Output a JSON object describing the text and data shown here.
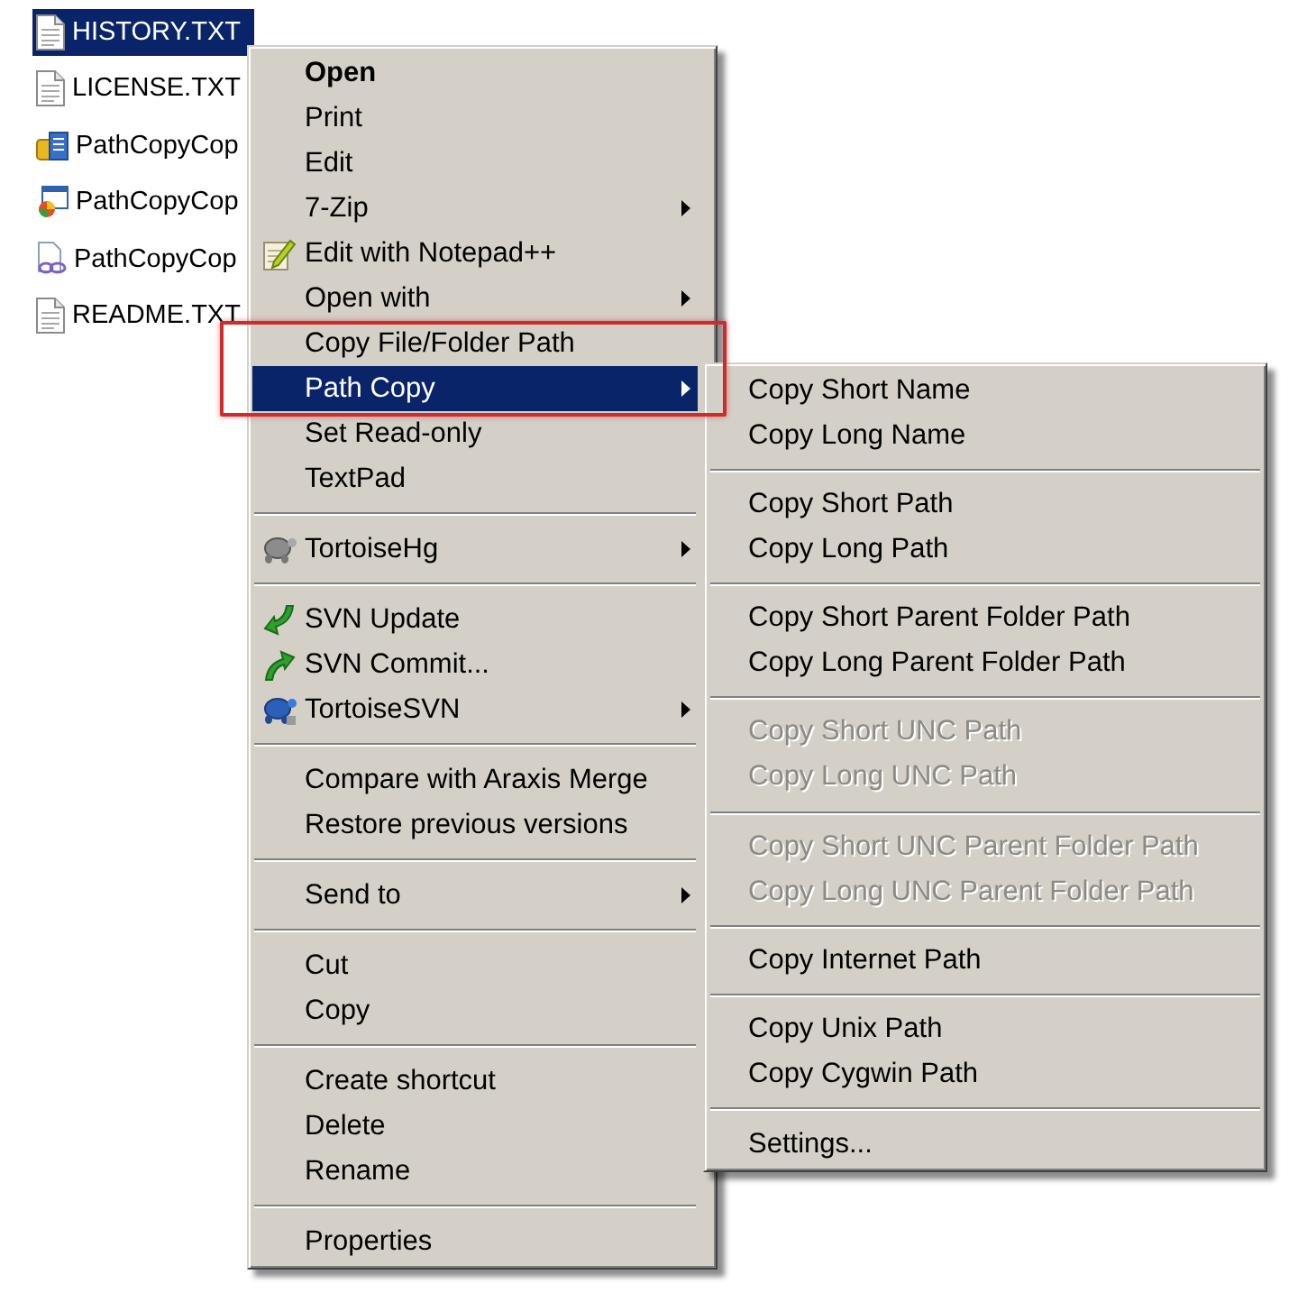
{
  "files": [
    {
      "name": "HISTORY.TXT",
      "kind": "text",
      "selected": true
    },
    {
      "name": "LICENSE.TXT",
      "kind": "text",
      "selected": false
    },
    {
      "name": "PathCopyCop",
      "kind": "package",
      "selected": false
    },
    {
      "name": "PathCopyCop",
      "kind": "installer",
      "selected": false
    },
    {
      "name": "PathCopyCop",
      "kind": "link",
      "selected": false
    },
    {
      "name": "README.TXT",
      "kind": "text",
      "selected": false
    }
  ],
  "context_menu": {
    "items": [
      {
        "kind": "item",
        "label": "Open",
        "default": true,
        "selected": false,
        "has_submenu": false
      },
      {
        "kind": "item",
        "label": "Print",
        "default": false,
        "selected": false,
        "has_submenu": false
      },
      {
        "kind": "item",
        "label": "Edit",
        "default": false,
        "selected": false,
        "has_submenu": false
      },
      {
        "kind": "item",
        "label": "7-Zip",
        "default": false,
        "selected": false,
        "has_submenu": true
      },
      {
        "kind": "item",
        "label": "Edit with Notepad++",
        "default": false,
        "selected": false,
        "has_submenu": false
      },
      {
        "kind": "item",
        "label": "Open with",
        "default": false,
        "selected": false,
        "has_submenu": true
      },
      {
        "kind": "item",
        "label": "Copy File/Folder Path",
        "default": false,
        "selected": false,
        "has_submenu": false
      },
      {
        "kind": "item",
        "label": "Path Copy",
        "default": false,
        "selected": true,
        "has_submenu": true
      },
      {
        "kind": "item",
        "label": "Set Read-only",
        "default": false,
        "selected": false,
        "has_submenu": false
      },
      {
        "kind": "item",
        "label": "TextPad",
        "default": false,
        "selected": false,
        "has_submenu": false
      },
      {
        "kind": "separator"
      },
      {
        "kind": "item",
        "label": "TortoiseHg",
        "default": false,
        "selected": false,
        "has_submenu": true
      },
      {
        "kind": "separator"
      },
      {
        "kind": "item",
        "label": "SVN Update",
        "default": false,
        "selected": false,
        "has_submenu": false
      },
      {
        "kind": "item",
        "label": "SVN Commit...",
        "default": false,
        "selected": false,
        "has_submenu": false
      },
      {
        "kind": "item",
        "label": "TortoiseSVN",
        "default": false,
        "selected": false,
        "has_submenu": true
      },
      {
        "kind": "separator"
      },
      {
        "kind": "item",
        "label": "Compare with Araxis Merge",
        "default": false,
        "selected": false,
        "has_submenu": false
      },
      {
        "kind": "item",
        "label": "Restore previous versions",
        "default": false,
        "selected": false,
        "has_submenu": false
      },
      {
        "kind": "separator"
      },
      {
        "kind": "item",
        "label": "Send to",
        "default": false,
        "selected": false,
        "has_submenu": true
      },
      {
        "kind": "separator"
      },
      {
        "kind": "item",
        "label": "Cut",
        "default": false,
        "selected": false,
        "has_submenu": false
      },
      {
        "kind": "item",
        "label": "Copy",
        "default": false,
        "selected": false,
        "has_submenu": false
      },
      {
        "kind": "separator"
      },
      {
        "kind": "item",
        "label": "Create shortcut",
        "default": false,
        "selected": false,
        "has_submenu": false
      },
      {
        "kind": "item",
        "label": "Delete",
        "default": false,
        "selected": false,
        "has_submenu": false
      },
      {
        "kind": "item",
        "label": "Rename",
        "default": false,
        "selected": false,
        "has_submenu": false
      },
      {
        "kind": "separator"
      },
      {
        "kind": "item",
        "label": "Properties",
        "default": false,
        "selected": false,
        "has_submenu": false
      }
    ]
  },
  "path_copy_menu": {
    "items": [
      {
        "kind": "item",
        "label": "Copy Short Name",
        "selected": false,
        "disabled": false
      },
      {
        "kind": "item",
        "label": "Copy Long Name",
        "selected": false,
        "disabled": false
      },
      {
        "kind": "separator"
      },
      {
        "kind": "item",
        "label": "Copy Short Path",
        "selected": false,
        "disabled": false
      },
      {
        "kind": "item",
        "label": "Copy Long Path",
        "selected": false,
        "disabled": false
      },
      {
        "kind": "separator"
      },
      {
        "kind": "item",
        "label": "Copy Short Parent Folder Path",
        "selected": false,
        "disabled": false
      },
      {
        "kind": "item",
        "label": "Copy Long Parent Folder Path",
        "selected": false,
        "disabled": false
      },
      {
        "kind": "separator"
      },
      {
        "kind": "item",
        "label": "Copy Short UNC Path",
        "selected": false,
        "disabled": true
      },
      {
        "kind": "item",
        "label": "Copy Long UNC Path",
        "selected": false,
        "disabled": true
      },
      {
        "kind": "separator"
      },
      {
        "kind": "item",
        "label": "Copy Short UNC Parent Folder Path",
        "selected": false,
        "disabled": true
      },
      {
        "kind": "item",
        "label": "Copy Long UNC Parent Folder Path",
        "selected": false,
        "disabled": true
      },
      {
        "kind": "separator"
      },
      {
        "kind": "item",
        "label": "Copy Internet Path",
        "selected": false,
        "disabled": false
      },
      {
        "kind": "separator"
      },
      {
        "kind": "item",
        "label": "Copy Unix Path",
        "selected": false,
        "disabled": false
      },
      {
        "kind": "item",
        "label": "Copy Cygwin Path",
        "selected": false,
        "disabled": false
      },
      {
        "kind": "separator"
      },
      {
        "kind": "item",
        "label": "Settings...",
        "selected": false,
        "disabled": false
      }
    ]
  }
}
